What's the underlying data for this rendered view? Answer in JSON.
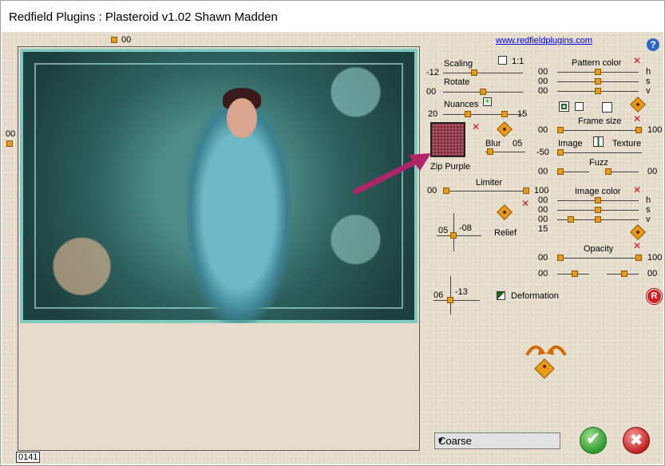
{
  "window": {
    "title": "Redfield Plugins : Plasteroid v1.02   Shawn Madden"
  },
  "top": {
    "h_offset": "00",
    "v_offset": "00",
    "link": "www.redfieldplugins.com"
  },
  "scaling": {
    "label": "Scaling",
    "value": "-12",
    "one_to_one": "1:1"
  },
  "rotate": {
    "label": "Rotate",
    "value": "00"
  },
  "nuances": {
    "label": "Nuances",
    "value_left": "20",
    "value_right": "15"
  },
  "swatch": {
    "label": "Zip Purple",
    "color": "#7a2a3a"
  },
  "blur": {
    "label": "Blur",
    "value": "05"
  },
  "limiter": {
    "label": "Limiter",
    "value_left": "00",
    "value_right": "100"
  },
  "relief": {
    "label": "Relief",
    "x": "05",
    "y": "-08"
  },
  "deformation_pad": {
    "x": "06",
    "y": "-13"
  },
  "deformation": {
    "label": "Deformation"
  },
  "pattern_color": {
    "label": "Pattern color",
    "h": "00",
    "s": "00",
    "v": "00",
    "h_label": "h",
    "s_label": "s",
    "v_label": "v"
  },
  "frame_size": {
    "label": "Frame size",
    "value_left": "00",
    "value_right": "100"
  },
  "image_texture": {
    "value": "-50",
    "image_label": "Image",
    "texture_label": "Texture"
  },
  "fuzz": {
    "label": "Fuzz",
    "value_left": "00",
    "value_right": "00"
  },
  "image_color": {
    "label": "Image color",
    "h": "00",
    "s": "00",
    "v": "00",
    "extra": "15",
    "h_label": "h",
    "s_label": "s",
    "v_label": "v"
  },
  "opacity": {
    "label": "Opacity",
    "value_left": "00",
    "value_right": "100",
    "row2_left": "00",
    "row2_right": "00"
  },
  "quality": {
    "selected": "Coarse"
  },
  "status": {
    "counter": "0141"
  },
  "buttons": {
    "ok": "✔",
    "cancel": "✖",
    "help": "?",
    "reset": "R"
  }
}
